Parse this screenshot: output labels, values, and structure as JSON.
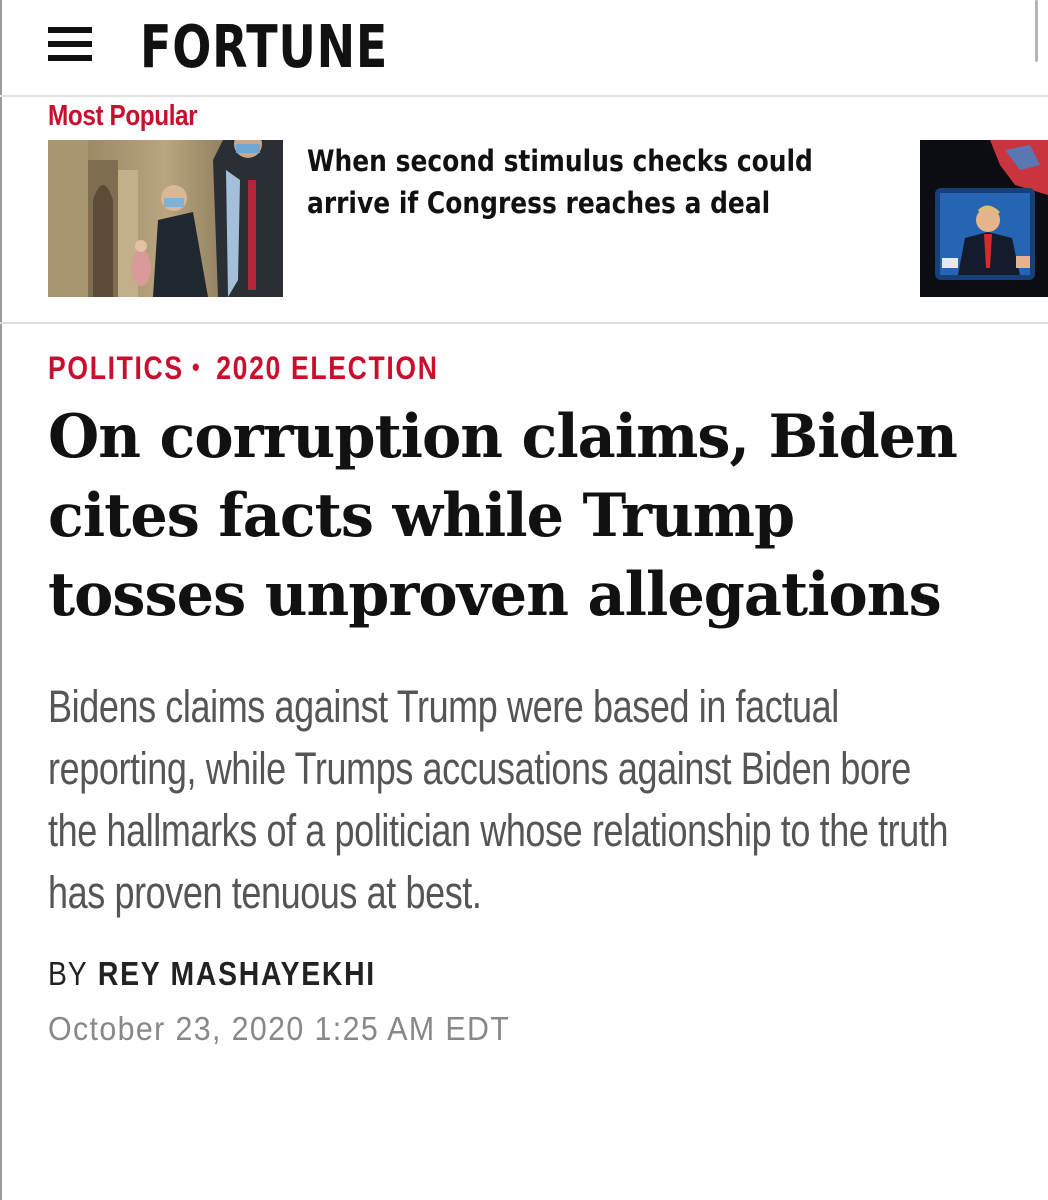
{
  "header": {
    "logo": "FORTUNE"
  },
  "most_popular": {
    "label": "Most Popular",
    "items": [
      {
        "headline": "When second stimulus checks could\narrive if Congress reaches a deal"
      }
    ]
  },
  "article": {
    "categories": [
      "POLITICS",
      "2020 ELECTION"
    ],
    "separator": "•",
    "headline": "On corruption claims, Biden cites facts while Trump tosses unproven allegations",
    "dek": "Bidens claims against Trump were based in factual reporting, while Trumps accusations against Biden bore the hallmarks of a politician whose relationship to the truth has proven tenuous at best.",
    "byline_prefix": "BY",
    "author": "REY MASHAYEKHI",
    "date": "October 23, 2020 1:25 AM EDT"
  },
  "colors": {
    "accent_red": "#c8102e",
    "dek_gray": "#555555",
    "date_gray": "#888888"
  }
}
